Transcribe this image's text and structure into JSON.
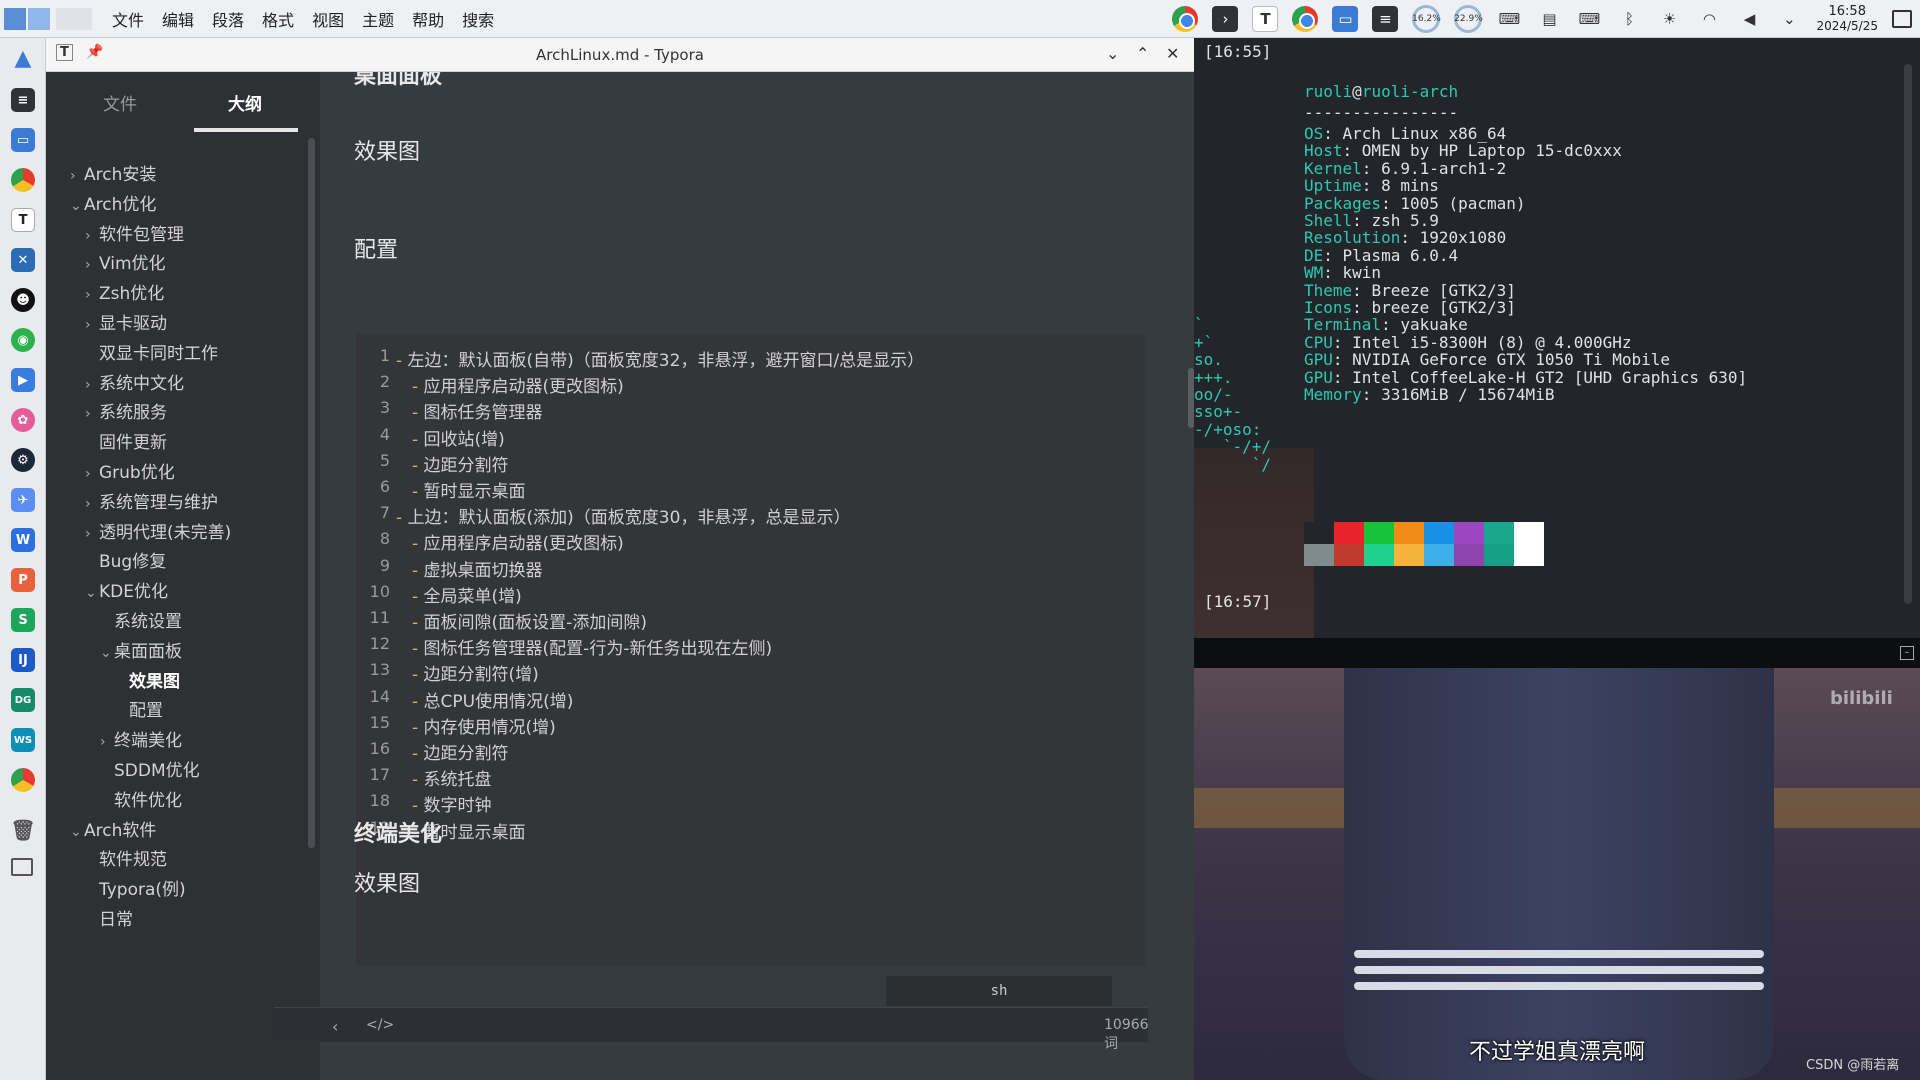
{
  "menubar": {
    "items": [
      "文件",
      "编辑",
      "段落",
      "格式",
      "视图",
      "主题",
      "帮助",
      "搜索"
    ],
    "cpu_meter": "16.2%",
    "mem_meter": "22.9%",
    "clock_time": "16:58",
    "clock_date": "2024/5/25"
  },
  "typora": {
    "window_title": "ArchLinux.md - Typora",
    "sidebar_tabs": [
      "文件",
      "大纲"
    ],
    "outline": [
      {
        "label": "Arch安装",
        "level": 0,
        "chev": "›"
      },
      {
        "label": "Arch优化",
        "level": 0,
        "chev": "⌄"
      },
      {
        "label": "软件包管理",
        "level": 1,
        "chev": "›"
      },
      {
        "label": "Vim优化",
        "level": 1,
        "chev": "›"
      },
      {
        "label": "Zsh优化",
        "level": 1,
        "chev": "›"
      },
      {
        "label": "显卡驱动",
        "level": 1,
        "chev": "›"
      },
      {
        "label": "双显卡同时工作",
        "level": 1,
        "chev": ""
      },
      {
        "label": "系统中文化",
        "level": 1,
        "chev": "›"
      },
      {
        "label": "系统服务",
        "level": 1,
        "chev": "›"
      },
      {
        "label": "固件更新",
        "level": 1,
        "chev": ""
      },
      {
        "label": "Grub优化",
        "level": 1,
        "chev": "›"
      },
      {
        "label": "系统管理与维护",
        "level": 1,
        "chev": "›"
      },
      {
        "label": "透明代理(未完善)",
        "level": 1,
        "chev": "›"
      },
      {
        "label": "Bug修复",
        "level": 1,
        "chev": ""
      },
      {
        "label": "KDE优化",
        "level": 1,
        "chev": "⌄"
      },
      {
        "label": "系统设置",
        "level": 2,
        "chev": ""
      },
      {
        "label": "桌面面板",
        "level": 2,
        "chev": "⌄"
      },
      {
        "label": "效果图",
        "level": 3,
        "chev": "",
        "current": true
      },
      {
        "label": "配置",
        "level": 3,
        "chev": ""
      },
      {
        "label": "终端美化",
        "level": 2,
        "chev": "›"
      },
      {
        "label": "SDDM优化",
        "level": 2,
        "chev": ""
      },
      {
        "label": "软件优化",
        "level": 2,
        "chev": ""
      },
      {
        "label": "Arch软件",
        "level": 0,
        "chev": "⌄"
      },
      {
        "label": "软件规范",
        "level": 1,
        "chev": ""
      },
      {
        "label": "Typora(例)",
        "level": 1,
        "chev": ""
      },
      {
        "label": "日常",
        "level": 1,
        "chev": ""
      }
    ],
    "headings": {
      "top_cut": "桌面面板",
      "h_effect": "效果图",
      "h_config": "配置",
      "h_terminal": "终端美化",
      "h_effect2": "效果图"
    },
    "code_lines": [
      {
        "indent": 0,
        "text": "左边：默认面板(自带)（面板宽度32，非悬浮，避开窗口/总是显示）"
      },
      {
        "indent": 1,
        "text": "应用程序启动器(更改图标)"
      },
      {
        "indent": 1,
        "text": "图标任务管理器"
      },
      {
        "indent": 1,
        "text": "回收站(增)"
      },
      {
        "indent": 1,
        "text": "边距分割符"
      },
      {
        "indent": 1,
        "text": "暂时显示桌面"
      },
      {
        "indent": 0,
        "text": "上边：默认面板(添加)（面板宽度30，非悬浮，总是显示）"
      },
      {
        "indent": 1,
        "text": "应用程序启动器(更改图标)"
      },
      {
        "indent": 1,
        "text": "虚拟桌面切换器"
      },
      {
        "indent": 1,
        "text": "全局菜单(增)"
      },
      {
        "indent": 1,
        "text": "面板间隙(面板设置-添加间隙)"
      },
      {
        "indent": 1,
        "text": "图标任务管理器(配置-行为-新任务出现在左侧)"
      },
      {
        "indent": 1,
        "text": "边距分割符(增)"
      },
      {
        "indent": 1,
        "text": "总CPU使用情况(增)"
      },
      {
        "indent": 1,
        "text": "内存使用情况(增)"
      },
      {
        "indent": 1,
        "text": "边距分割符"
      },
      {
        "indent": 1,
        "text": "系统托盘"
      },
      {
        "indent": 1,
        "text": "数字时钟"
      },
      {
        "indent": 1,
        "text": "暂时显示桌面"
      }
    ],
    "code_lang": "sh",
    "word_count": "10966 词"
  },
  "terminal": {
    "time1": "[16:55]",
    "time2": "[16:57]",
    "user": "ruoli",
    "host": "ruoli-arch",
    "separator": "----------------",
    "info": [
      {
        "key": "OS",
        "value": "Arch Linux x86_64"
      },
      {
        "key": "Host",
        "value": "OMEN by HP Laptop 15-dc0xxx"
      },
      {
        "key": "Kernel",
        "value": "6.9.1-arch1-2"
      },
      {
        "key": "Uptime",
        "value": "8 mins"
      },
      {
        "key": "Packages",
        "value": "1005 (pacman)"
      },
      {
        "key": "Shell",
        "value": "zsh 5.9"
      },
      {
        "key": "Resolution",
        "value": "1920x1080"
      },
      {
        "key": "DE",
        "value": "Plasma 6.0.4"
      },
      {
        "key": "WM",
        "value": "kwin"
      },
      {
        "key": "Theme",
        "value": "Breeze [GTK2/3]"
      },
      {
        "key": "Icons",
        "value": "breeze [GTK2/3]"
      },
      {
        "key": "Terminal",
        "value": "yakuake"
      },
      {
        "key": "CPU",
        "value": "Intel i5-8300H (8) @ 4.000GHz"
      },
      {
        "key": "GPU",
        "value": "NVIDIA GeForce GTX 1050 Ti Mobile"
      },
      {
        "key": "GPU",
        "value": "Intel CoffeeLake-H GT2 [UHD Graphics 630]"
      },
      {
        "key": "Memory",
        "value": "3316MiB / 15674MiB"
      }
    ],
    "ascii_tail": [
      {
        "row": 11,
        "text": "`"
      },
      {
        "row": 12,
        "text": "+`"
      },
      {
        "row": 13,
        "text": "so."
      },
      {
        "row": 14,
        "text": "+++."
      },
      {
        "row": 15,
        "text": "oo/-"
      },
      {
        "row": 16,
        "text": "sso+-"
      },
      {
        "row": 17,
        "text": "-/+oso:"
      },
      {
        "row": 18,
        "text": "   `-/+/"
      },
      {
        "row": 19,
        "text": "      `/"
      }
    ],
    "palette_top": [
      "#22252a",
      "#e8242b",
      "#17c33b",
      "#f18b17",
      "#1a8fe6",
      "#9b47c2",
      "#1aa88c",
      "#ffffff"
    ],
    "palette_bottom": [
      "#7f8c8d",
      "#c0392b",
      "#1fd08e",
      "#f6b33a",
      "#3daee9",
      "#8e44ad",
      "#16a085",
      "#ffffff"
    ]
  },
  "video": {
    "subtitle": "不过学姐真漂亮啊",
    "watermark": "bilibili",
    "credit": "CSDN @雨若离"
  }
}
